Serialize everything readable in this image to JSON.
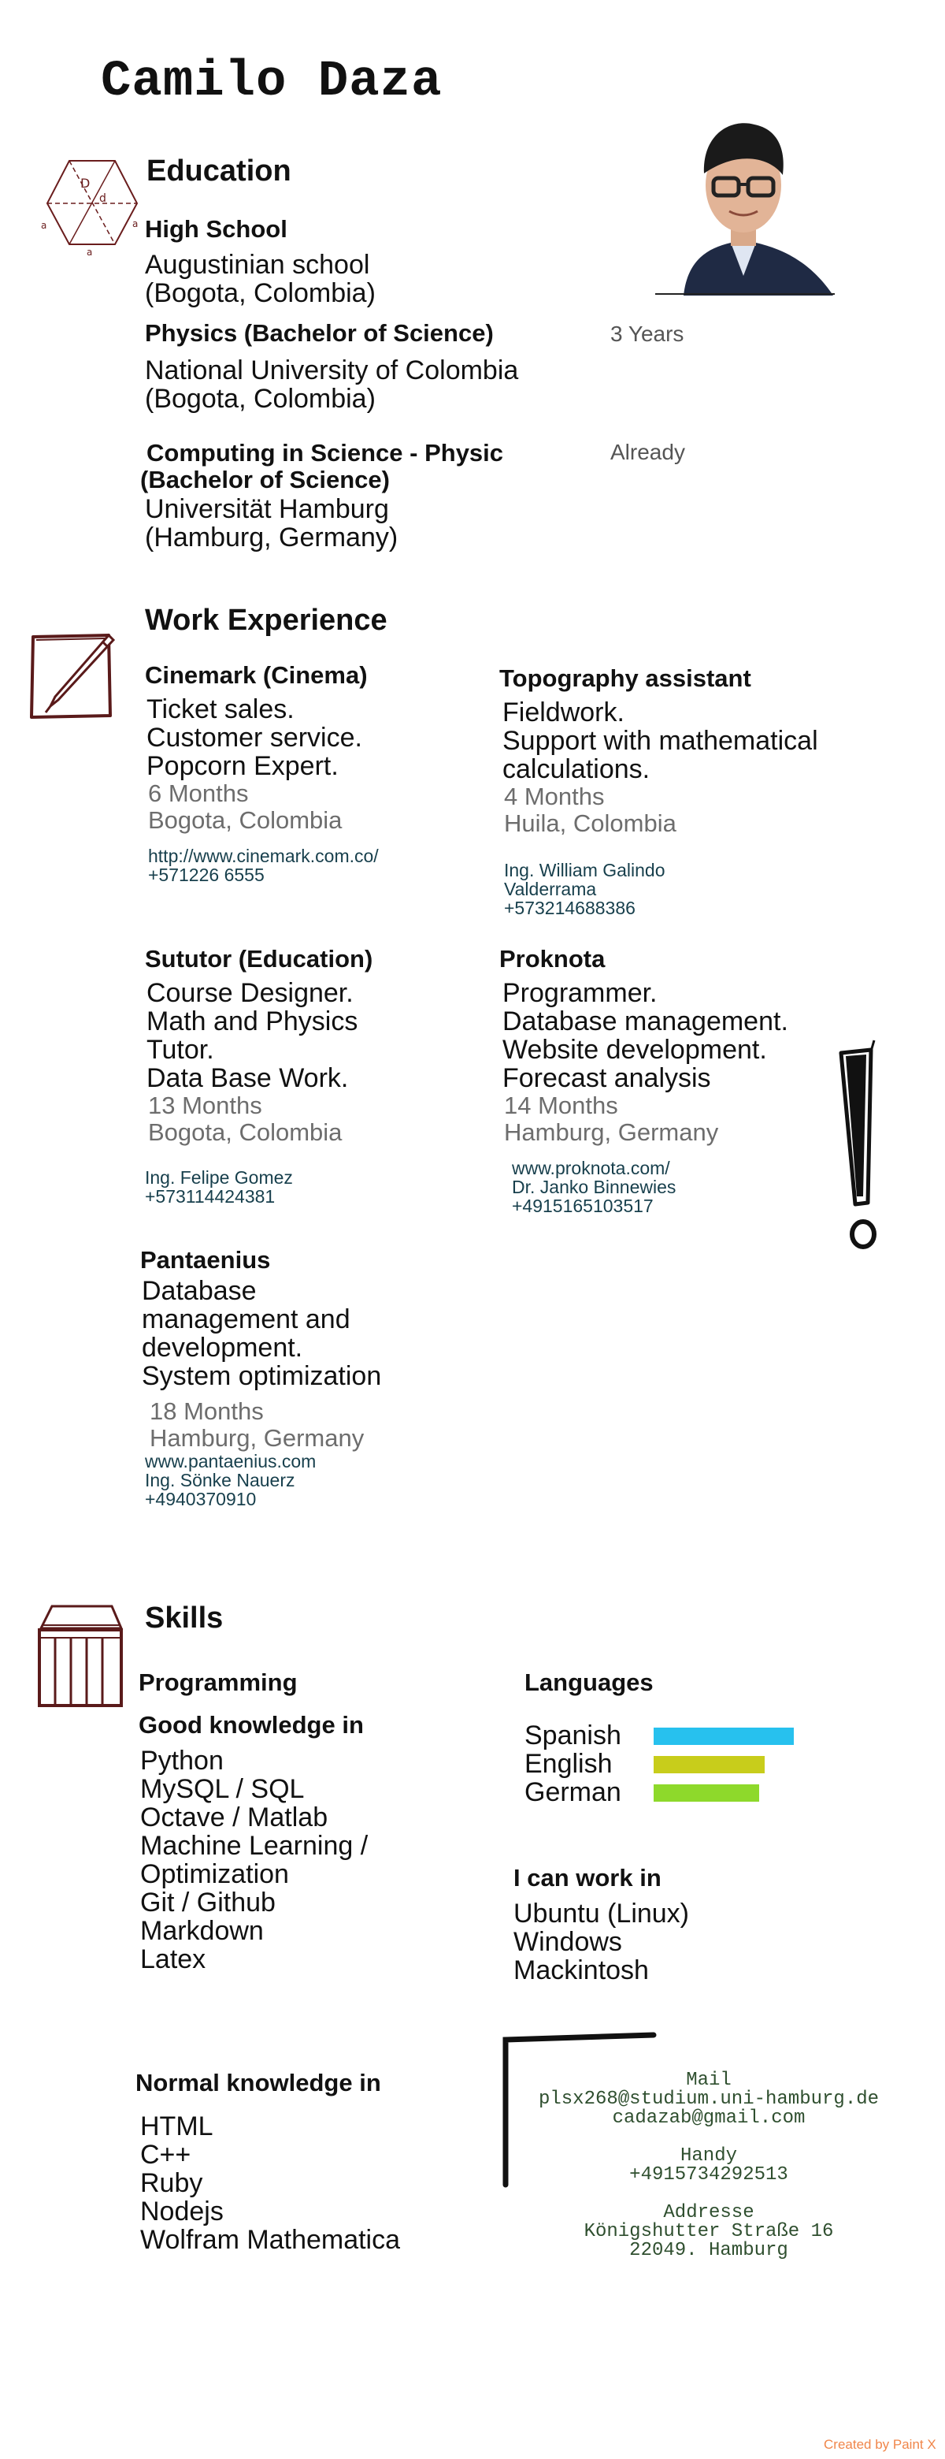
{
  "name": "Camilo Daza",
  "education": {
    "heading": "Education",
    "items": [
      {
        "title": "High School",
        "lines": [
          "Augustinian school",
          "(Bogota, Colombia)"
        ],
        "duration": ""
      },
      {
        "title": "Physics (Bachelor of Science)",
        "lines": [
          "National University of Colombia",
          "(Bogota, Colombia)"
        ],
        "duration": "3 Years"
      },
      {
        "title_lines": [
          "Computing in Science - Physic",
          "(Bachelor of Science)"
        ],
        "lines": [
          "Universität Hamburg",
          "(Hamburg, Germany)"
        ],
        "duration": "Already"
      }
    ]
  },
  "work": {
    "heading": "Work Experience",
    "jobs": [
      {
        "title": "Cinemark (Cinema)",
        "tasks": [
          "Ticket sales.",
          "Customer service.",
          "Popcorn Expert."
        ],
        "duration": "6 Months",
        "location": "Bogota, Colombia",
        "contact": [
          "http://www.cinemark.com.co/",
          "+571226 6555"
        ]
      },
      {
        "title": "Topography assistant",
        "tasks": [
          "Fieldwork.",
          "Support with mathematical",
          "calculations."
        ],
        "duration": "4 Months",
        "location": "Huila, Colombia",
        "contact": [
          "Ing. William Galindo",
          "Valderrama",
          "+573214688386"
        ]
      },
      {
        "title": "Sututor (Education)",
        "tasks": [
          "Course Designer.",
          "Math and Physics",
          "Tutor.",
          "Data Base Work."
        ],
        "duration": "13 Months",
        "location": "Bogota, Colombia",
        "contact": [
          "Ing. Felipe Gomez",
          "+573114424381"
        ]
      },
      {
        "title": "Proknota",
        "tasks": [
          "Programmer.",
          "Database management.",
          "Website development.",
          "Forecast analysis"
        ],
        "duration": "14 Months",
        "location": "Hamburg, Germany",
        "contact": [
          "www.proknota.com/",
          "Dr. Janko Binnewies",
          "+4915165103517"
        ]
      },
      {
        "title": "Pantaenius",
        "tasks": [
          "Database",
          "management and",
          "development.",
          "System optimization"
        ],
        "duration": "18 Months",
        "location": "Hamburg, Germany",
        "contact": [
          "www.pantaenius.com",
          "Ing. Sönke Nauerz",
          "+4940370910"
        ]
      }
    ]
  },
  "skills": {
    "heading": "Skills",
    "programming_heading": "Programming",
    "good_heading": "Good knowledge in",
    "good_items": [
      "Python",
      "MySQL / SQL",
      "Octave / Matlab",
      "Machine Learning /",
      "Optimization",
      "Git / Github",
      "Markdown",
      "Latex"
    ],
    "normal_heading": "Normal knowledge in",
    "normal_items": [
      "HTML",
      "C++",
      "Ruby",
      "Nodejs",
      "Wolfram Mathematica"
    ],
    "languages_heading": "Languages",
    "languages": [
      {
        "name": "Spanish",
        "level": 1.0,
        "color": "#27c1ee"
      },
      {
        "name": "English",
        "level": 0.79,
        "color": "#c8cd1b"
      },
      {
        "name": "German",
        "level": 0.75,
        "color": "#8ed92b"
      }
    ],
    "os_heading": "I can work in",
    "os_items": [
      "Ubuntu (Linux)",
      "Windows",
      "Mackintosh"
    ]
  },
  "contact": {
    "mail_label": "Mail",
    "mail_1": "plsx268@studium.uni-hamburg.de",
    "mail_2": "cadazab@gmail.com",
    "phone_label": "Handy",
    "phone": "+4915734292513",
    "address_label": "Addresse",
    "address_1": "Königshutter Straße 16",
    "address_2": "22049. Hamburg"
  },
  "footer": "Created by Paint X",
  "icons": [
    "hexagon-sketch-icon",
    "pencil-note-icon",
    "building-sketch-icon",
    "exclamation-mark-icon"
  ]
}
